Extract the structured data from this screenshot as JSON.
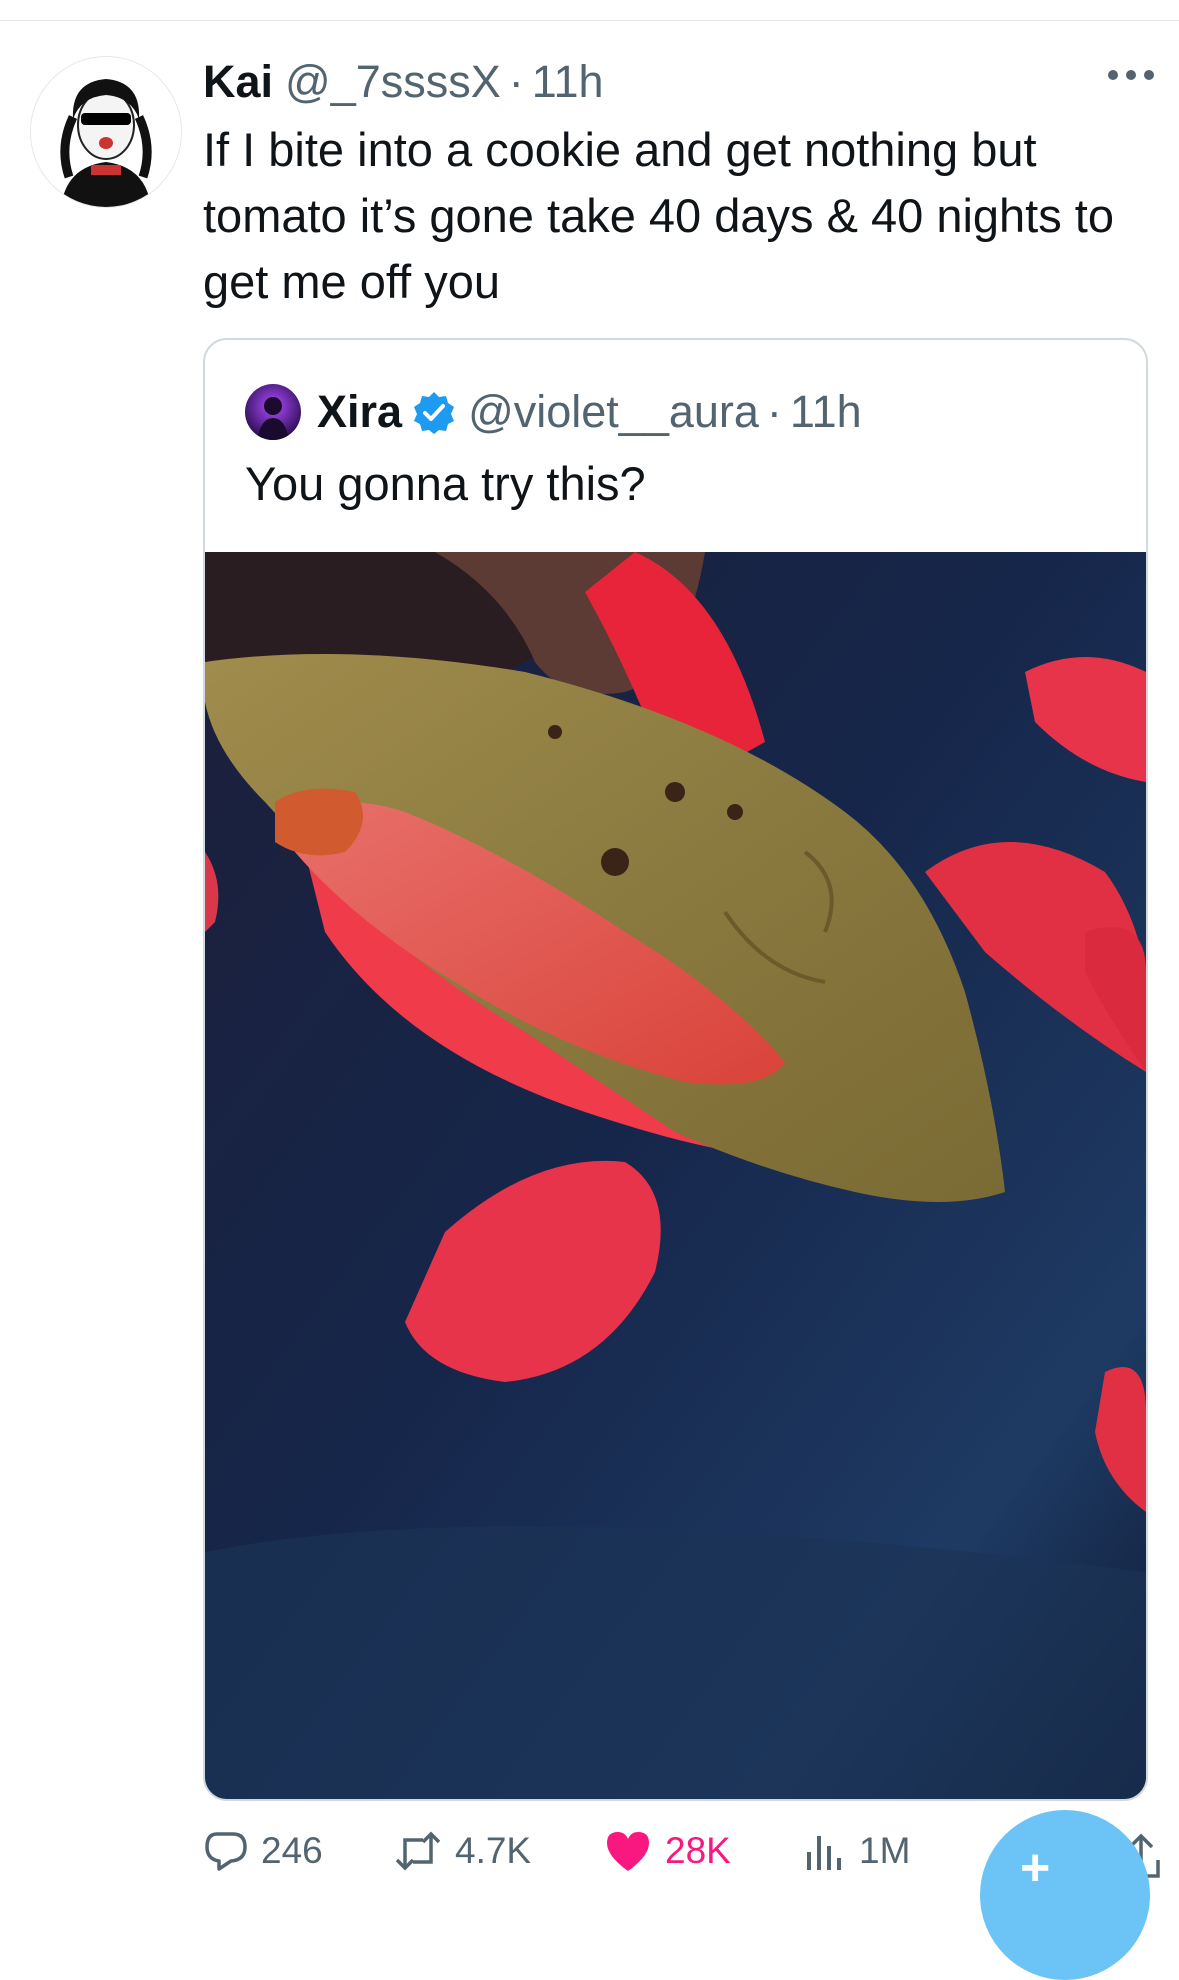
{
  "tweet": {
    "author_name": "Kai",
    "author_handle": "@_7ssssX",
    "separator": "·",
    "time": "11h",
    "text": "If I bite into a cookie and get nothing but tomato it’s gone take 40 days & 40 nights to get me off you"
  },
  "quote": {
    "author_name": "Xira",
    "author_handle": "@violet__aura",
    "separator": "·",
    "time": "11h",
    "text": "You gonna try this?"
  },
  "actions": {
    "replies": "246",
    "retweets": "4.7K",
    "likes": "28K",
    "views": "1M"
  },
  "colors": {
    "text_primary": "#0f1419",
    "text_secondary": "#536471",
    "like_active": "#f91880",
    "verified": "#1d9bf0",
    "border": "#cfd9de",
    "fab": "#6cc3f5"
  },
  "icons": [
    "more-icon",
    "verified-icon",
    "reply-icon",
    "retweet-icon",
    "like-icon",
    "views-icon",
    "bookmark-icon",
    "share-icon",
    "compose-icon"
  ]
}
